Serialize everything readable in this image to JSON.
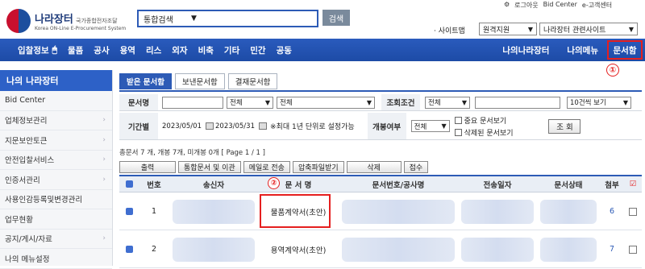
{
  "header": {
    "logo_title": "나라장터",
    "logo_title_suffix": "국가종합전자조달",
    "logo_sub": "Korea ON-Line E-Procurement System",
    "search_select": "통합검색",
    "search_button": "검색",
    "top_links": [
      "로그아웃",
      "Bid Center",
      "e-고객센터"
    ],
    "sitemap_label": "· 사이트맵",
    "dropdown1": "원격지원",
    "dropdown2": "나라장터 관련사이트"
  },
  "nav": {
    "first": "입찰정보",
    "items": [
      "물품",
      "공사",
      "용역",
      "리스",
      "외자",
      "비축",
      "기타",
      "민간",
      "공동"
    ],
    "right": [
      "나의나라장터",
      "나의메뉴"
    ],
    "docbox": "문서함"
  },
  "markers": {
    "m1": "①",
    "m2": "②"
  },
  "sidebar": {
    "title": "나의 나라장터",
    "items": [
      "Bid Center",
      "업체정보관리",
      "지문보안토큰",
      "안전입찰서비스",
      "인증서관리",
      "사용인감등록및변경관리",
      "업무현황",
      "공지/게시/자료",
      "나의 메뉴설정"
    ]
  },
  "tabs": [
    "받은 문서함",
    "보낸문서함",
    "결재문서함"
  ],
  "filters": {
    "doc_name_label": "문서명",
    "sel_all1": "전체",
    "sel_all2": "전체",
    "cond_label": "조회조건",
    "sel_all3": "전체",
    "page_size": "10건씩 보기",
    "period_label": "기간별",
    "date_from": "2023/05/01",
    "date_to": "2023/05/31",
    "period_note": "※최대 1년 단위로 설정가능",
    "open_label": "개봉여부",
    "sel_all4": "전체",
    "chk_important": "중요 문서보기",
    "chk_deleted": "삭제된 문서보기",
    "query_button": "조 회"
  },
  "info": "총문서 7 개, 개봉 7개, 미개봉 0개 [ Page 1 / 1 ]",
  "actions": [
    "출력",
    "통합문서 및 이관",
    "메일로 전송",
    "압축파일받기",
    "삭제",
    "접수"
  ],
  "table": {
    "headers": [
      "번호",
      "송신자",
      "문 서 명",
      "문서번호/공사명",
      "전송일자",
      "문서상태",
      "첨부"
    ],
    "rows": [
      {
        "no": "1",
        "doc": "물품계약서(초안)",
        "att": "6"
      },
      {
        "no": "2",
        "doc": "용역계약서(초안)",
        "att": "7"
      }
    ]
  }
}
